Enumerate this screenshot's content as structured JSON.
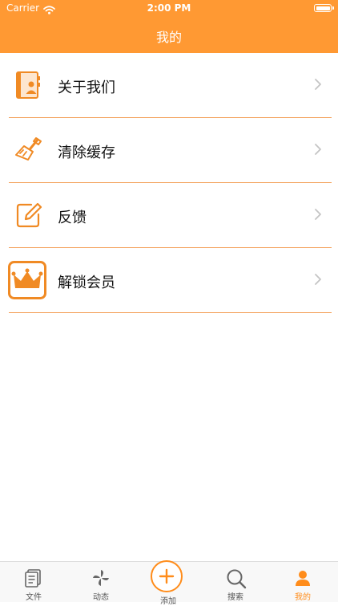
{
  "status_bar": {
    "carrier": "Carrier",
    "time": "2:00 PM"
  },
  "nav": {
    "title": "我的"
  },
  "colors": {
    "accent": "#FF9933",
    "divider": "#F4A460",
    "tab_active": "#FF8C1A"
  },
  "menu": [
    {
      "label": "关于我们",
      "icon": "contact-book-icon"
    },
    {
      "label": "清除缓存",
      "icon": "broom-icon"
    },
    {
      "label": "反馈",
      "icon": "edit-icon"
    },
    {
      "label": "解锁会员",
      "icon": "crown-icon"
    }
  ],
  "tabbar": {
    "items": [
      {
        "label": "文件",
        "icon": "document-icon"
      },
      {
        "label": "动态",
        "icon": "pinwheel-icon"
      },
      {
        "label": "添加",
        "icon": "plus-icon"
      },
      {
        "label": "搜索",
        "icon": "search-icon"
      },
      {
        "label": "我的",
        "icon": "person-icon",
        "active": true
      }
    ]
  }
}
